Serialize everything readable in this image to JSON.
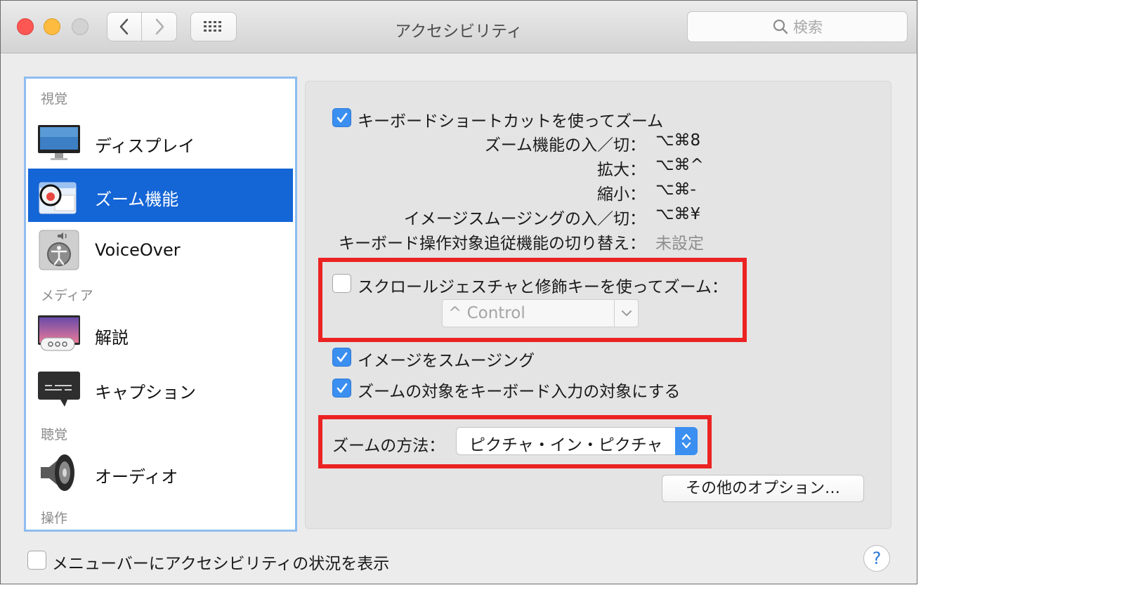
{
  "window": {
    "title": "アクセシビリティ"
  },
  "search": {
    "placeholder": "検索"
  },
  "sidebar": {
    "sections": {
      "vision": "視覚",
      "media": "メディア",
      "hearing": "聴覚",
      "interaction": "操作"
    },
    "items": [
      {
        "label": "ディスプレイ",
        "icon": "display-icon"
      },
      {
        "label": "ズーム機能",
        "icon": "zoom-icon",
        "selected": true
      },
      {
        "label": "VoiceOver",
        "icon": "voiceover-icon"
      },
      {
        "label": "解説",
        "icon": "descriptions-icon"
      },
      {
        "label": "キャプション",
        "icon": "captions-icon"
      },
      {
        "label": "オーディオ",
        "icon": "speaker-icon"
      }
    ]
  },
  "zoom": {
    "keyboard_shortcuts": {
      "label": "キーボードショートカットを使ってズーム",
      "checked": true
    },
    "shortcuts": [
      {
        "label": "ズーム機能の入／切：",
        "value": "⌥⌘8"
      },
      {
        "label": "拡大：",
        "value": "⌥⌘^"
      },
      {
        "label": "縮小：",
        "value": "⌥⌘-"
      },
      {
        "label": "イメージスムージングの入／切：",
        "value": "⌥⌘¥"
      },
      {
        "label": "キーボード操作対象追従機能の切り替え：",
        "value": "未設定"
      }
    ],
    "scroll_gesture": {
      "label": "スクロールジェスチャと修飾キーを使ってズーム：",
      "checked": false
    },
    "modifier_popup": {
      "value": "^ Control"
    },
    "smooth_images": {
      "label": "イメージをスムージング",
      "checked": true
    },
    "follow_keyboard": {
      "label": "ズームの対象をキーボード入力の対象にする",
      "checked": true
    },
    "zoom_style": {
      "label": "ズームの方法：",
      "value": "ピクチャ・イン・ピクチャ"
    },
    "more_options_label": "その他のオプション…"
  },
  "footer": {
    "menubar_status": {
      "label": "メニューバーにアクセシビリティの状況を表示",
      "checked": false
    },
    "help_label": "?"
  },
  "colors": {
    "accent": "#1465d6",
    "checkbox": "#3b8ff0",
    "highlight": "#ec2323"
  }
}
